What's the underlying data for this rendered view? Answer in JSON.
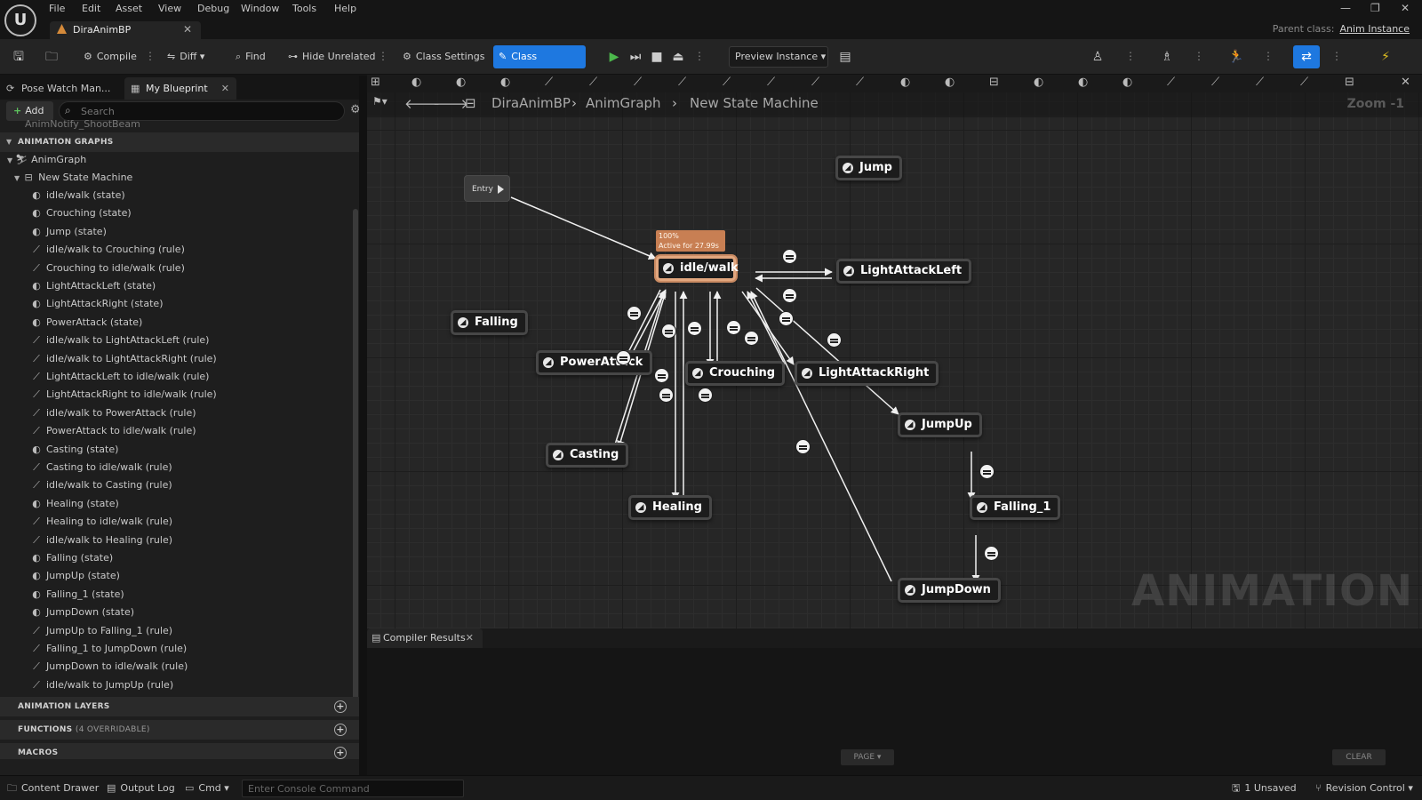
{
  "titlebar": {
    "menu": [
      "File",
      "Edit",
      "Asset",
      "View",
      "Debug",
      "Window",
      "Tools",
      "Help"
    ],
    "asset_tab": "DiraAnimBP",
    "parent_class_label": "Parent class:",
    "parent_class_value": "Anim Instance"
  },
  "toolbar": {
    "compile": "Compile",
    "diff": "Diff",
    "find": "Find",
    "hide_unrelated": "Hide Unrelated",
    "class_settings": "Class Settings",
    "class_defaults": "Class Defaults",
    "preview_instance": "Preview Instance"
  },
  "left_panel": {
    "tabs": [
      "Pose Watch Man...",
      "My Blueprint"
    ],
    "add_label": "Add",
    "search_placeholder": "Search",
    "cut_item": "AnimNotify_ShootBeam",
    "section_anim_graphs": "ANIMATION GRAPHS",
    "anim_graph": "AnimGraph",
    "state_machine": "New State Machine",
    "items": [
      {
        "label": "idle/walk (state)",
        "type": "state"
      },
      {
        "label": "Crouching (state)",
        "type": "state"
      },
      {
        "label": "Jump (state)",
        "type": "state"
      },
      {
        "label": "idle/walk to Crouching (rule)",
        "type": "rule"
      },
      {
        "label": "Crouching to idle/walk (rule)",
        "type": "rule"
      },
      {
        "label": "LightAttackLeft (state)",
        "type": "state"
      },
      {
        "label": "LightAttackRight (state)",
        "type": "state"
      },
      {
        "label": "PowerAttack (state)",
        "type": "state"
      },
      {
        "label": "idle/walk to LightAttackLeft (rule)",
        "type": "rule"
      },
      {
        "label": "idle/walk to LightAttackRight (rule)",
        "type": "rule"
      },
      {
        "label": "LightAttackLeft to idle/walk (rule)",
        "type": "rule"
      },
      {
        "label": "LightAttackRight to idle/walk (rule)",
        "type": "rule"
      },
      {
        "label": "idle/walk to PowerAttack (rule)",
        "type": "rule"
      },
      {
        "label": "PowerAttack to idle/walk (rule)",
        "type": "rule"
      },
      {
        "label": "Casting (state)",
        "type": "state"
      },
      {
        "label": "Casting to idle/walk (rule)",
        "type": "rule"
      },
      {
        "label": "idle/walk to Casting (rule)",
        "type": "rule"
      },
      {
        "label": "Healing (state)",
        "type": "state"
      },
      {
        "label": "Healing to idle/walk (rule)",
        "type": "rule"
      },
      {
        "label": "idle/walk to Healing (rule)",
        "type": "rule"
      },
      {
        "label": "Falling (state)",
        "type": "state"
      },
      {
        "label": "JumpUp (state)",
        "type": "state"
      },
      {
        "label": "Falling_1 (state)",
        "type": "state"
      },
      {
        "label": "JumpDown (state)",
        "type": "state"
      },
      {
        "label": "JumpUp to Falling_1 (rule)",
        "type": "rule"
      },
      {
        "label": "Falling_1 to JumpDown (rule)",
        "type": "rule"
      },
      {
        "label": "JumpDown to idle/walk (rule)",
        "type": "rule"
      },
      {
        "label": "idle/walk to JumpUp (rule)",
        "type": "rule"
      }
    ],
    "section_anim_layers": "ANIMATION LAYERS",
    "section_functions": "FUNCTIONS",
    "functions_sub": "(4 OVERRIDABLE)",
    "section_macros": "MACROS"
  },
  "graph": {
    "breadcrumb": [
      "DiraAnimBP",
      "AnimGraph",
      "New State Machine"
    ],
    "zoom": "Zoom -1",
    "watermark": "ANIMATION",
    "entry": "Entry",
    "active_tip_line1": "100%",
    "active_tip_line2": "Active for 27.99s",
    "nodes": {
      "idle_walk": "idle/walk",
      "jump": "Jump",
      "light_attack_left": "LightAttackLeft",
      "falling": "Falling",
      "power_attack": "PowerAttack",
      "crouching": "Crouching",
      "light_attack_right": "LightAttackRight",
      "jump_up": "JumpUp",
      "casting": "Casting",
      "healing": "Healing",
      "falling_1": "Falling_1",
      "jump_down": "JumpDown"
    }
  },
  "compiler": {
    "tab": "Compiler Results",
    "page": "PAGE",
    "clear": "CLEAR"
  },
  "statusbar": {
    "content_drawer": "Content Drawer",
    "output_log": "Output Log",
    "cmd": "Cmd",
    "console_placeholder": "Enter Console Command",
    "unsaved": "1 Unsaved",
    "revision_control": "Revision Control"
  },
  "colors": {
    "accent": "#1e78e0",
    "active_node": "#e2a77f",
    "active_tip": "#c87f53"
  }
}
